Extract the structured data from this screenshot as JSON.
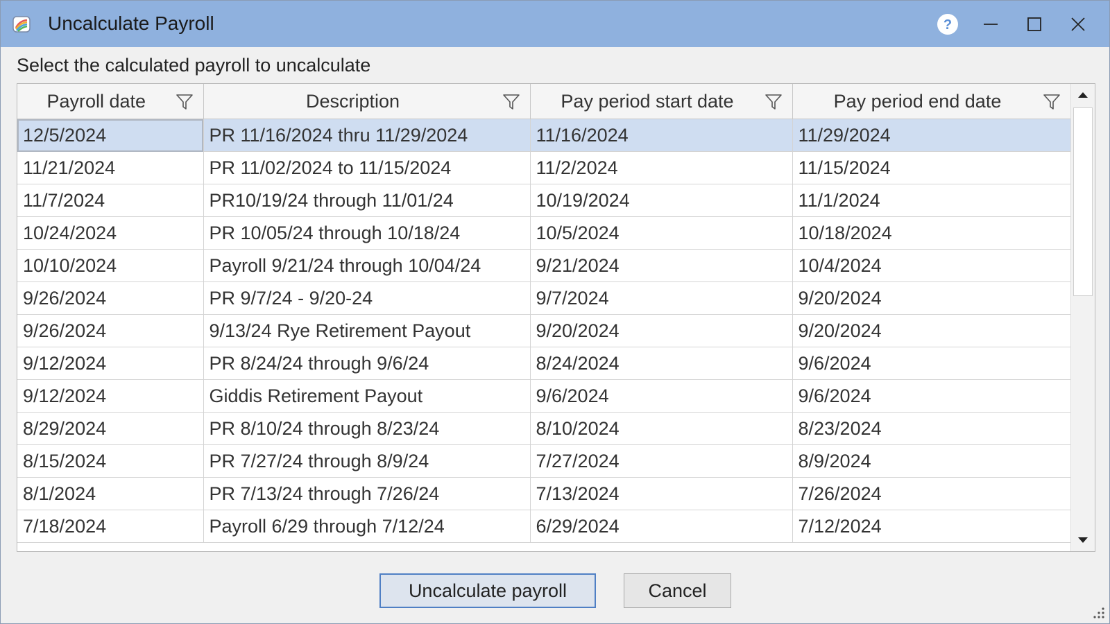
{
  "window": {
    "title": "Uncalculate Payroll",
    "icon": "payroll-app-icon"
  },
  "titlebar_controls": [
    "help-icon",
    "minimize-icon",
    "maximize-icon",
    "close-icon"
  ],
  "instruction": "Select the calculated payroll to uncalculate",
  "grid": {
    "columns": [
      {
        "label": "Payroll date",
        "icon": "filter-icon"
      },
      {
        "label": "Description",
        "icon": "filter-icon"
      },
      {
        "label": "Pay period start date",
        "icon": "filter-icon"
      },
      {
        "label": "Pay period end date",
        "icon": "filter-icon"
      }
    ],
    "selected_row_index": 0,
    "rows": [
      [
        "12/5/2024",
        "PR 11/16/2024 thru 11/29/2024",
        "11/16/2024",
        "11/29/2024"
      ],
      [
        "11/21/2024",
        "PR 11/02/2024 to 11/15/2024",
        "11/2/2024",
        "11/15/2024"
      ],
      [
        "11/7/2024",
        "PR10/19/24 through 11/01/24",
        "10/19/2024",
        "11/1/2024"
      ],
      [
        "10/24/2024",
        "PR 10/05/24 through 10/18/24",
        "10/5/2024",
        "10/18/2024"
      ],
      [
        "10/10/2024",
        "Payroll 9/21/24 through 10/04/24",
        "9/21/2024",
        "10/4/2024"
      ],
      [
        "9/26/2024",
        "PR 9/7/24 - 9/20-24",
        "9/7/2024",
        "9/20/2024"
      ],
      [
        "9/26/2024",
        "9/13/24 Rye Retirement Payout",
        "9/20/2024",
        "9/20/2024"
      ],
      [
        "9/12/2024",
        "PR 8/24/24 through 9/6/24",
        "8/24/2024",
        "9/6/2024"
      ],
      [
        "9/12/2024",
        "Giddis Retirement Payout",
        "9/6/2024",
        "9/6/2024"
      ],
      [
        "8/29/2024",
        "PR 8/10/24 through 8/23/24",
        "8/10/2024",
        "8/23/2024"
      ],
      [
        "8/15/2024",
        "PR 7/27/24 through 8/9/24",
        "7/27/2024",
        "8/9/2024"
      ],
      [
        "8/1/2024",
        "PR 7/13/24 through 7/26/24",
        "7/13/2024",
        "7/26/2024"
      ],
      [
        "7/18/2024",
        "Payroll 6/29 through 7/12/24",
        "6/29/2024",
        "7/12/2024"
      ]
    ]
  },
  "buttons": {
    "uncalculate": "Uncalculate payroll",
    "cancel": "Cancel"
  },
  "colors": {
    "titlebar": "#8fb1de",
    "selected_row": "#cfddf1",
    "primary_border": "#4f7fc4"
  }
}
